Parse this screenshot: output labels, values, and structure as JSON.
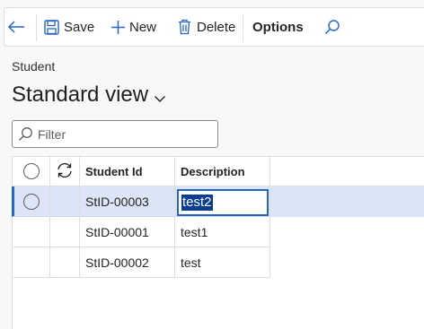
{
  "toolbar": {
    "save_label": "Save",
    "new_label": "New",
    "delete_label": "Delete",
    "options_label": "Options",
    "icons": [
      "back-arrow-icon",
      "save-icon",
      "plus-icon",
      "trash-icon",
      "search-icon"
    ]
  },
  "page": {
    "caption": "Student",
    "view_name": "Standard view"
  },
  "filter": {
    "placeholder": "Filter",
    "value": ""
  },
  "grid": {
    "columns": [
      "Student Id",
      "Description"
    ],
    "rows": [
      {
        "student_id": "StID-00003",
        "description": "test2",
        "selected": true,
        "editing": true
      },
      {
        "student_id": "StID-00001",
        "description": "test1",
        "selected": false
      },
      {
        "student_id": "StID-00002",
        "description": "test",
        "selected": false
      }
    ]
  },
  "colors": {
    "accent": "#2566c2",
    "selected_row": "#dbe5f7",
    "text_highlight": "#0a3d91"
  }
}
